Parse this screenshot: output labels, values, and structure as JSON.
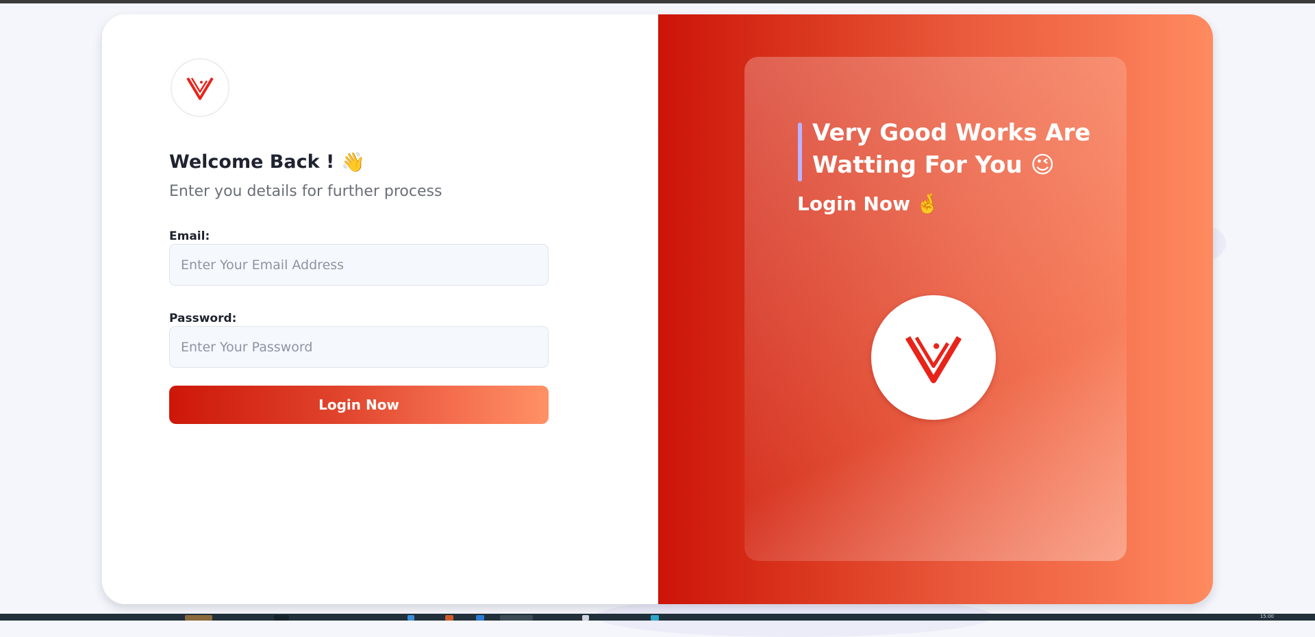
{
  "login": {
    "heading": "Welcome Back !",
    "heading_emoji": "👋",
    "subtitle": "Enter you details for further process",
    "email_label": "Email:",
    "email_placeholder": "Enter Your Email Address",
    "email_value": "",
    "password_label": "Password:",
    "password_placeholder": "Enter Your Password",
    "password_value": "",
    "submit_label": "Login Now"
  },
  "promo": {
    "quote": "Very Good Works Are Watting For You 😉",
    "cta": "Login Now",
    "cta_emoji": "🤞"
  },
  "icons": {
    "logo": "v-brand-logo-icon",
    "wave": "waving-hand-icon",
    "wink": "winking-face-icon",
    "fingers": "crossed-fingers-icon"
  },
  "colors": {
    "accent_start": "#cd1708",
    "accent_end": "#ff9166",
    "quote_bar": "#b9b4ff"
  },
  "taskbar": {
    "clock": "15:00"
  }
}
